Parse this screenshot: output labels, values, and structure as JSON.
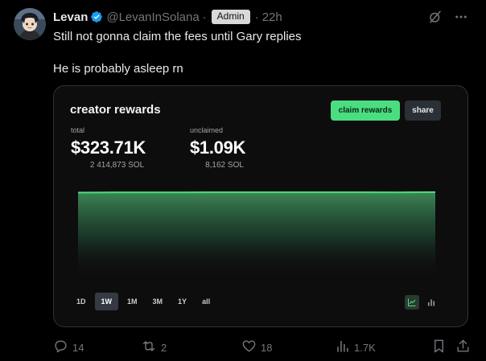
{
  "post": {
    "author": {
      "display_name": "Levan",
      "handle": "@LevanInSolana",
      "badge": "Admin",
      "time": "22h",
      "separator": "·"
    },
    "text_lines": [
      "Still not gonna claim the fees until Gary replies",
      "He is probably asleep rn"
    ]
  },
  "card": {
    "title": "creator rewards",
    "claim_label": "claim rewards",
    "share_label": "share",
    "total": {
      "label": "total",
      "value": "$323.71K",
      "sub": "2 414,873 SOL"
    },
    "unclaimed": {
      "label": "unclaimed",
      "value": "$1.09K",
      "sub": "8,162 SOL"
    },
    "ranges": [
      "1D",
      "1W",
      "1M",
      "3M",
      "1Y",
      "all"
    ],
    "active_range": "1W",
    "colors": {
      "accent": "#4ade80",
      "card_bg": "#0d0d0e"
    }
  },
  "chart_data": {
    "type": "area",
    "x": [
      0,
      1,
      2,
      3,
      4,
      5,
      6,
      7,
      8,
      9,
      10
    ],
    "values": [
      1,
      1.002,
      1.003,
      1.003,
      1.004,
      1.004,
      1.004,
      1.004,
      1.004,
      1.003,
      1.005
    ],
    "title": "",
    "xlabel": "",
    "ylabel": "",
    "grid": false
  },
  "actions": {
    "replies": "14",
    "reposts": "2",
    "likes": "18",
    "views": "1.7K"
  },
  "icons": {
    "verified": "verified-badge-icon",
    "grok": "grok-icon",
    "more": "more-icon",
    "reply": "reply-icon",
    "repost": "repost-icon",
    "like": "heart-icon",
    "views": "views-icon",
    "bookmark": "bookmark-icon",
    "share": "share-icon"
  },
  "theme": {
    "background": "#000000",
    "text": "#e7e9ea",
    "muted": "#71767b",
    "verified_blue": "#1d9bf0"
  }
}
